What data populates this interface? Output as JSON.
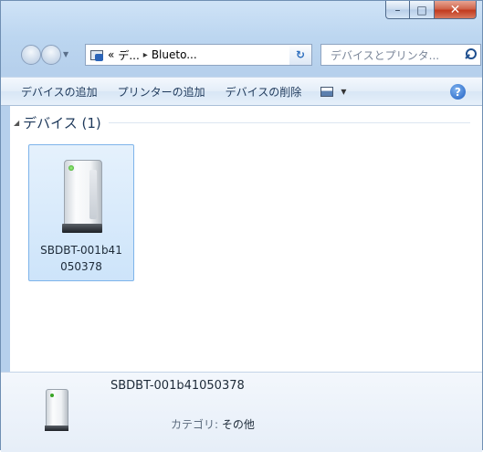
{
  "window": {
    "controls": {
      "minimize": "–",
      "maximize": "□",
      "close": "✕"
    }
  },
  "navigation": {
    "back_label": "",
    "forward_label": "",
    "breadcrumb": [
      "«",
      "デ...",
      "Blueto..."
    ],
    "search_placeholder": "デバイスとプリンタ..."
  },
  "toolbar": {
    "add_device": "デバイスの追加",
    "add_printer": "プリンターの追加",
    "remove_device": "デバイスの削除",
    "view_dropdown": "▾",
    "help": "?"
  },
  "content": {
    "group_title": "デバイス (1)",
    "devices": [
      {
        "name": "SBDBT-001b41050378"
      }
    ]
  },
  "details": {
    "name": "SBDBT-001b41050378",
    "category_label": "カテゴリ:",
    "category_value": "その他"
  }
}
